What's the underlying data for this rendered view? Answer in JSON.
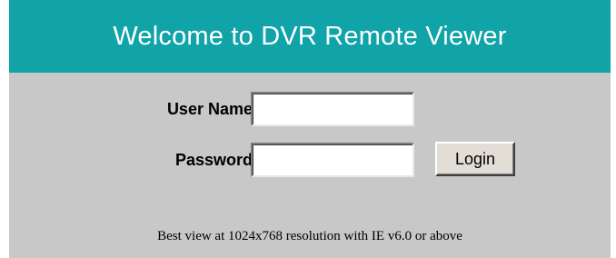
{
  "header": {
    "title": "Welcome to DVR Remote Viewer"
  },
  "login_form": {
    "username_label": "User Name",
    "username_value": "",
    "password_label": "Password",
    "password_value": "",
    "login_button_label": "Login"
  },
  "footer": {
    "note": "Best view at 1024x768 resolution with IE v6.0 or above"
  },
  "colors": {
    "header_bg": "#10a3a8",
    "panel_bg": "#c8c8c8",
    "header_text": "#ffffff"
  }
}
